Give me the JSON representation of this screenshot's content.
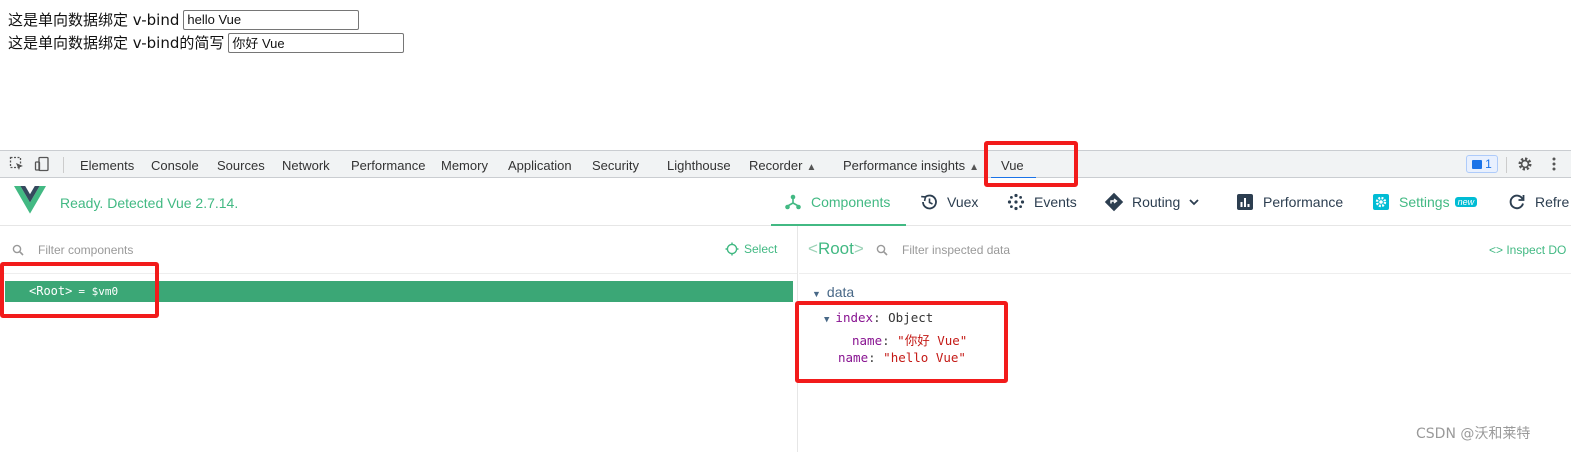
{
  "page": {
    "row1_label": "这是单向数据绑定 v-bind",
    "row1_value": "hello Vue",
    "row2_label": "这是单向数据绑定 v-bind的简写",
    "row2_value": "你好 Vue"
  },
  "devtools_tabs": {
    "elements": "Elements",
    "console": "Console",
    "sources": "Sources",
    "network": "Network",
    "performance": "Performance",
    "memory": "Memory",
    "application": "Application",
    "security": "Security",
    "lighthouse": "Lighthouse",
    "recorder": "Recorder",
    "performance_insights": "Performance insights",
    "vue": "Vue",
    "active": "Vue",
    "message_count": "1"
  },
  "vue_header": {
    "status": "Ready. Detected Vue 2.7.14.",
    "nav": {
      "components": "Components",
      "vuex": "Vuex",
      "events": "Events",
      "routing": "Routing",
      "performance": "Performance",
      "settings": "Settings",
      "settings_badge": "new",
      "refresh": "Refre"
    },
    "active_nav": "Components"
  },
  "components_pane": {
    "filter_placeholder": "Filter components",
    "select_label": "Select",
    "root_label": "<Root>",
    "root_vm": "= $vm0"
  },
  "inspector": {
    "title_open": "<",
    "title_name": "Root",
    "title_close": ">",
    "filter_placeholder": "Filter inspected data",
    "inspect_dom": "<> Inspect DO",
    "section": "data",
    "props": {
      "index_key": "index",
      "index_type": "Object",
      "inner_name_key": "name",
      "inner_name_value": "\"你好 Vue\"",
      "name_key": "name",
      "name_value": "\"hello Vue\""
    }
  },
  "watermark": "CSDN @沃和莱特",
  "colors": {
    "vue_green": "#42b983",
    "root_row": "#3ba776",
    "annotation": "#f21b1b",
    "devtools_active": "#1a73e8"
  }
}
